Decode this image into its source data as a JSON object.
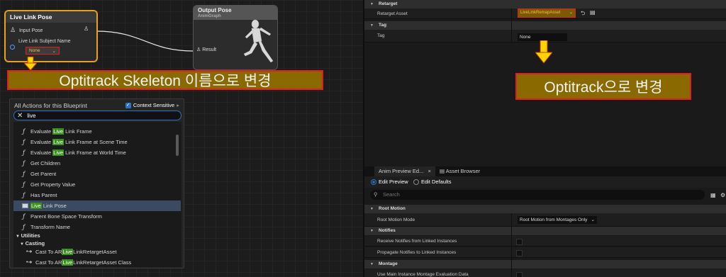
{
  "graph": {
    "live_link_pose_node": {
      "title": "Live Link Pose",
      "input_pose_label": "Input Pose",
      "subject_label": "Live Link Subject Name",
      "subject_value": "None"
    },
    "output_pose_node": {
      "title": "Output Pose",
      "subtitle": "AnimGraph",
      "result_label": "Result"
    },
    "callout_left": "Optitrack Skeleton 이름으로 변경",
    "callout_right": "Optitrack으로 변경"
  },
  "actions_menu": {
    "title": "All Actions for this Blueprint",
    "context_sensitive_label": "Context Sensitive",
    "search_value": "live",
    "items": [
      {
        "pre": "Evaluate ",
        "hl": "Live",
        "post": " Link Frame"
      },
      {
        "pre": "Evaluate ",
        "hl": "Live",
        "post": " Link Frame at Scene Time"
      },
      {
        "pre": "Evaluate ",
        "hl": "Live",
        "post": " Link Frame at World Time"
      },
      {
        "pre": "Get Children",
        "hl": "",
        "post": ""
      },
      {
        "pre": "Get Parent",
        "hl": "",
        "post": ""
      },
      {
        "pre": "Get Property Value",
        "hl": "",
        "post": ""
      },
      {
        "pre": "Has Parent",
        "hl": "",
        "post": ""
      },
      {
        "pre": "",
        "hl": "Live",
        "post": " Link Pose"
      },
      {
        "pre": "Parent Bone Space Transform",
        "hl": "",
        "post": ""
      },
      {
        "pre": "Transform Name",
        "hl": "",
        "post": ""
      }
    ],
    "category_utilities": "Utilities",
    "category_casting": "Casting",
    "cast_items": [
      {
        "pre": "Cast To AR",
        "hl": "Live",
        "post": "LinkRetargetAsset"
      },
      {
        "pre": "Cast To AR",
        "hl": "Live",
        "post": "LinkRetargetAsset Class"
      }
    ]
  },
  "details": {
    "section_retarget": "Retarget",
    "retarget_asset_label": "Retarget Asset",
    "retarget_asset_value": "LiveLinkRemapAsset",
    "section_tag": "Tag",
    "tag_label": "Tag",
    "tag_value": "None",
    "tab_anim_preview": "Anim Preview Ed...",
    "tab_asset_browser": "Asset Browser",
    "edit_preview_label": "Edit Preview",
    "edit_defaults_label": "Edit Defaults",
    "search_placeholder": "Search",
    "section_root_motion": "Root Motion",
    "root_motion_mode_label": "Root Motion Mode",
    "root_motion_mode_value": "Root Motion from Montages Only",
    "section_notifies": "Notifies",
    "receive_notifies_label": "Receive Notifies from Linked Instances",
    "propagate_notifies_label": "Propagate Notifies to Linked Instances",
    "section_montage": "Montage",
    "montage_row_label": "Use Main Instance Montage Evaluation Data"
  },
  "colors": {
    "accent_blue": "#2a72c8",
    "callout_bg": "#8a6a00",
    "callout_border": "#e02020",
    "highlight_green": "#3d8f1f",
    "node_border_orange": "#e8a31a",
    "arrow_yellow": "#ffd400"
  }
}
